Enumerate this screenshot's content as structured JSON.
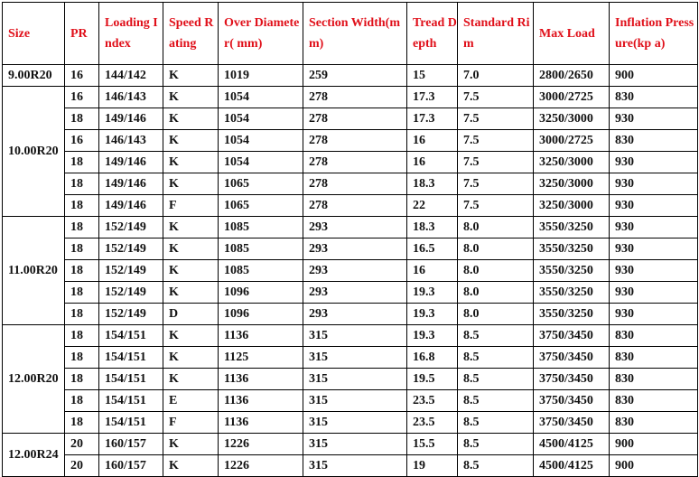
{
  "table": {
    "header_color": "#e0101a",
    "headers": [
      {
        "key": "size",
        "label": "Size"
      },
      {
        "key": "pr",
        "label": "PR"
      },
      {
        "key": "loading_index",
        "label": "Loading Index"
      },
      {
        "key": "speed_rating",
        "label": "Speed Rating"
      },
      {
        "key": "over_diameter",
        "label": "Over Diameter( mm)"
      },
      {
        "key": "section_width",
        "label": "Section Width(mm)"
      },
      {
        "key": "tread_depth",
        "label": "Tread Depth"
      },
      {
        "key": "standard_rim",
        "label": "Standard Rim"
      },
      {
        "key": "max_load",
        "label": "Max Load"
      },
      {
        "key": "inflation_pressure",
        "label": "Inflation Pressure(kp a)"
      }
    ],
    "groups": [
      {
        "size": "9.00R20",
        "rows": [
          {
            "pr": "16",
            "loading_index": "144/142",
            "speed_rating": "K",
            "over_diameter": "1019",
            "section_width": "259",
            "tread_depth": "15",
            "standard_rim": "7.0",
            "max_load": "2800/2650",
            "inflation_pressure": "900"
          }
        ]
      },
      {
        "size": "10.00R20",
        "rows": [
          {
            "pr": "16",
            "loading_index": "146/143",
            "speed_rating": "K",
            "over_diameter": "1054",
            "section_width": "278",
            "tread_depth": "17.3",
            "standard_rim": "7.5",
            "max_load": "3000/2725",
            "inflation_pressure": "830"
          },
          {
            "pr": "18",
            "loading_index": "149/146",
            "speed_rating": "K",
            "over_diameter": "1054",
            "section_width": "278",
            "tread_depth": "17.3",
            "standard_rim": "7.5",
            "max_load": "3250/3000",
            "inflation_pressure": "930"
          },
          {
            "pr": "16",
            "loading_index": "146/143",
            "speed_rating": "K",
            "over_diameter": "1054",
            "section_width": "278",
            "tread_depth": "16",
            "standard_rim": "7.5",
            "max_load": "3000/2725",
            "inflation_pressure": "830"
          },
          {
            "pr": "18",
            "loading_index": "149/146",
            "speed_rating": "K",
            "over_diameter": "1054",
            "section_width": "278",
            "tread_depth": "16",
            "standard_rim": "7.5",
            "max_load": "3250/3000",
            "inflation_pressure": "930"
          },
          {
            "pr": "18",
            "loading_index": "149/146",
            "speed_rating": "K",
            "over_diameter": "1065",
            "section_width": "278",
            "tread_depth": "18.3",
            "standard_rim": "7.5",
            "max_load": "3250/3000",
            "inflation_pressure": "930"
          },
          {
            "pr": "18",
            "loading_index": "149/146",
            "speed_rating": "F",
            "over_diameter": "1065",
            "section_width": "278",
            "tread_depth": "22",
            "standard_rim": "7.5",
            "max_load": "3250/3000",
            "inflation_pressure": "930"
          }
        ]
      },
      {
        "size": "11.00R20",
        "rows": [
          {
            "pr": "18",
            "loading_index": "152/149",
            "speed_rating": "K",
            "over_diameter": "1085",
            "section_width": "293",
            "tread_depth": "18.3",
            "standard_rim": "8.0",
            "max_load": "3550/3250",
            "inflation_pressure": "930"
          },
          {
            "pr": "18",
            "loading_index": "152/149",
            "speed_rating": "K",
            "over_diameter": "1085",
            "section_width": "293",
            "tread_depth": "16.5",
            "standard_rim": "8.0",
            "max_load": "3550/3250",
            "inflation_pressure": "930"
          },
          {
            "pr": "18",
            "loading_index": "152/149",
            "speed_rating": "K",
            "over_diameter": "1085",
            "section_width": "293",
            "tread_depth": "16",
            "standard_rim": "8.0",
            "max_load": "3550/3250",
            "inflation_pressure": "930"
          },
          {
            "pr": "18",
            "loading_index": "152/149",
            "speed_rating": "K",
            "over_diameter": "1096",
            "section_width": "293",
            "tread_depth": "19.3",
            "standard_rim": "8.0",
            "max_load": "3550/3250",
            "inflation_pressure": "930"
          },
          {
            "pr": "18",
            "loading_index": "152/149",
            "speed_rating": "D",
            "over_diameter": "1096",
            "section_width": "293",
            "tread_depth": "19.3",
            "standard_rim": "8.0",
            "max_load": "3550/3250",
            "inflation_pressure": "930"
          }
        ]
      },
      {
        "size": "12.00R20",
        "rows": [
          {
            "pr": "18",
            "loading_index": "154/151",
            "speed_rating": "K",
            "over_diameter": "1136",
            "section_width": "315",
            "tread_depth": "19.3",
            "standard_rim": "8.5",
            "max_load": "3750/3450",
            "inflation_pressure": "830"
          },
          {
            "pr": "18",
            "loading_index": "154/151",
            "speed_rating": "K",
            "over_diameter": "1125",
            "section_width": "315",
            "tread_depth": "16.8",
            "standard_rim": "8.5",
            "max_load": "3750/3450",
            "inflation_pressure": "830"
          },
          {
            "pr": "18",
            "loading_index": "154/151",
            "speed_rating": "K",
            "over_diameter": "1136",
            "section_width": "315",
            "tread_depth": "19.5",
            "standard_rim": "8.5",
            "max_load": "3750/3450",
            "inflation_pressure": "830"
          },
          {
            "pr": "18",
            "loading_index": "154/151",
            "speed_rating": "E",
            "over_diameter": "1136",
            "section_width": "315",
            "tread_depth": "23.5",
            "standard_rim": "8.5",
            "max_load": "3750/3450",
            "inflation_pressure": "830"
          },
          {
            "pr": "18",
            "loading_index": "154/151",
            "speed_rating": "F",
            "over_diameter": "1136",
            "section_width": "315",
            "tread_depth": "23.5",
            "standard_rim": "8.5",
            "max_load": "3750/3450",
            "inflation_pressure": "830"
          }
        ]
      },
      {
        "size": "12.00R24",
        "rows": [
          {
            "pr": "20",
            "loading_index": "160/157",
            "speed_rating": "K",
            "over_diameter": "1226",
            "section_width": "315",
            "tread_depth": "15.5",
            "standard_rim": "8.5",
            "max_load": "4500/4125",
            "inflation_pressure": "900"
          },
          {
            "pr": "20",
            "loading_index": "160/157",
            "speed_rating": "K",
            "over_diameter": "1226",
            "section_width": "315",
            "tread_depth": "19",
            "standard_rim": "8.5",
            "max_load": "4500/4125",
            "inflation_pressure": "900"
          }
        ]
      }
    ]
  }
}
